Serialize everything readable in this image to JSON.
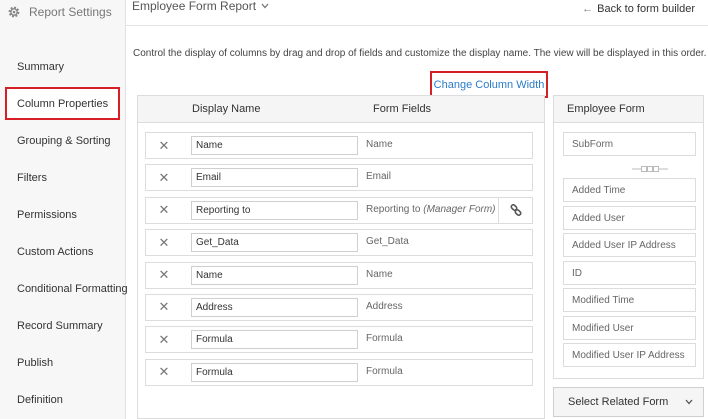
{
  "sidebar": {
    "title": "Report Settings",
    "items": [
      {
        "label": "Summary",
        "active": false
      },
      {
        "label": "Column Properties",
        "active": true
      },
      {
        "label": "Grouping & Sorting",
        "active": false
      },
      {
        "label": "Filters",
        "active": false
      },
      {
        "label": "Permissions",
        "active": false
      },
      {
        "label": "Custom Actions",
        "active": false
      },
      {
        "label": "Conditional Formatting",
        "active": false
      },
      {
        "label": "Record Summary",
        "active": false
      },
      {
        "label": "Publish",
        "active": false
      },
      {
        "label": "Definition",
        "active": false
      }
    ]
  },
  "header": {
    "report_title": "Employee Form Report",
    "back_link": "Back to form builder"
  },
  "main": {
    "description": "Control the display of columns by drag and drop of fields and customize the display name. The view will be displayed in this order.",
    "change_width_link": "Change Column Width",
    "columns": {
      "display_name": "Display Name",
      "form_fields": "Form Fields"
    },
    "rows": [
      {
        "display": "Name",
        "field": "Name",
        "sub": ""
      },
      {
        "display": "Email",
        "field": "Email",
        "sub": ""
      },
      {
        "display": "Reporting to",
        "field": "Reporting to",
        "sub": "(Manager Form)"
      },
      {
        "display": "Get_Data",
        "field": "Get_Data",
        "sub": ""
      },
      {
        "display": "Name",
        "field": "Name",
        "sub": ""
      },
      {
        "display": "Address",
        "field": "Address",
        "sub": ""
      },
      {
        "display": "Formula",
        "field": "Formula",
        "sub": ""
      },
      {
        "display": "Formula",
        "field": "Formula",
        "sub": ""
      }
    ]
  },
  "right_panel": {
    "title": "Employee Form",
    "subform": "SubForm",
    "fields": [
      "Added Time",
      "Added User",
      "Added User IP Address",
      "ID",
      "Modified Time",
      "Modified User",
      "Modified User IP Address"
    ],
    "select_related": "Select Related Form"
  },
  "colors": {
    "accent_red": "#d61f26",
    "link_blue": "#2b7cc9"
  }
}
